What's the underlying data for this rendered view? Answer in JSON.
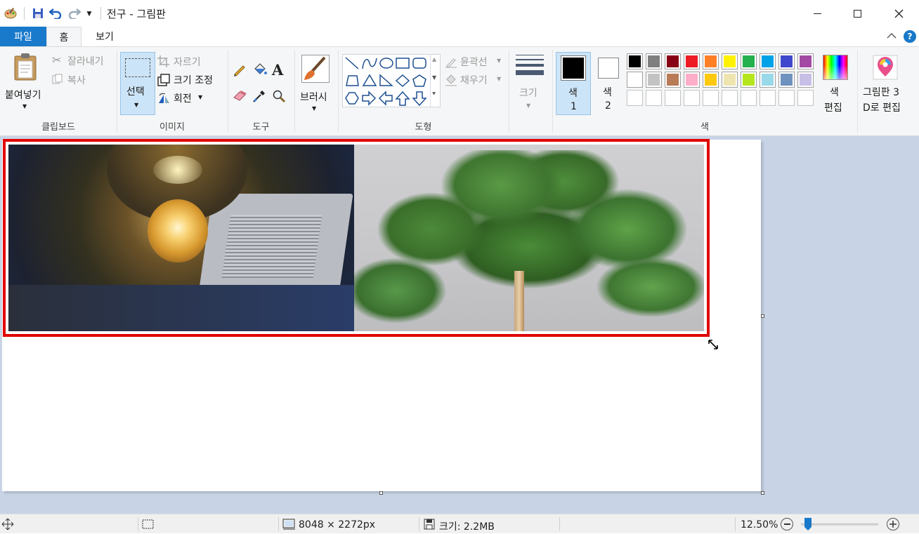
{
  "window": {
    "title": "전구 - 그림판",
    "minimize": "minimize-icon",
    "maximize": "maximize-icon",
    "close": "close-icon"
  },
  "tabs": {
    "file": "파일",
    "home": "홈",
    "view": "보기"
  },
  "clipboard": {
    "paste": "붙여넣기",
    "cut": "잘라내기",
    "copy": "복사",
    "group": "클립보드"
  },
  "image": {
    "select": "선택",
    "crop": "자르기",
    "resize": "크기 조정",
    "rotate": "회전",
    "group": "이미지"
  },
  "tools": {
    "group": "도구"
  },
  "brushes": {
    "label": "브러시"
  },
  "shapes": {
    "outline": "윤곽선",
    "fill": "채우기",
    "group": "도형"
  },
  "size": {
    "label": "크기"
  },
  "colors": {
    "color1_label": "색",
    "color1_num": "1",
    "color2_label": "색",
    "color2_num": "2",
    "edit_label_1": "색",
    "edit_label_2": "편집",
    "group": "색",
    "color1": "#000000",
    "color2": "#ffffff",
    "palette_row1": [
      "#000000",
      "#7f7f7f",
      "#880015",
      "#ed1c24",
      "#ff7f27",
      "#fff200",
      "#22b14c",
      "#00a2e8",
      "#3f48cc",
      "#a349a4"
    ],
    "palette_row2": [
      "#ffffff",
      "#c3c3c3",
      "#b97a57",
      "#ffaec9",
      "#ffc90e",
      "#efe4b0",
      "#b5e61d",
      "#99d9ea",
      "#7092be",
      "#c8bfe7"
    ]
  },
  "paint3d": {
    "line1": "그림판 3",
    "line2": "D로 편집"
  },
  "status": {
    "dimensions": "8048 × 2272px",
    "size": "크기: 2.2MB",
    "zoom": "12.50%",
    "zoom_level": 0.12
  }
}
